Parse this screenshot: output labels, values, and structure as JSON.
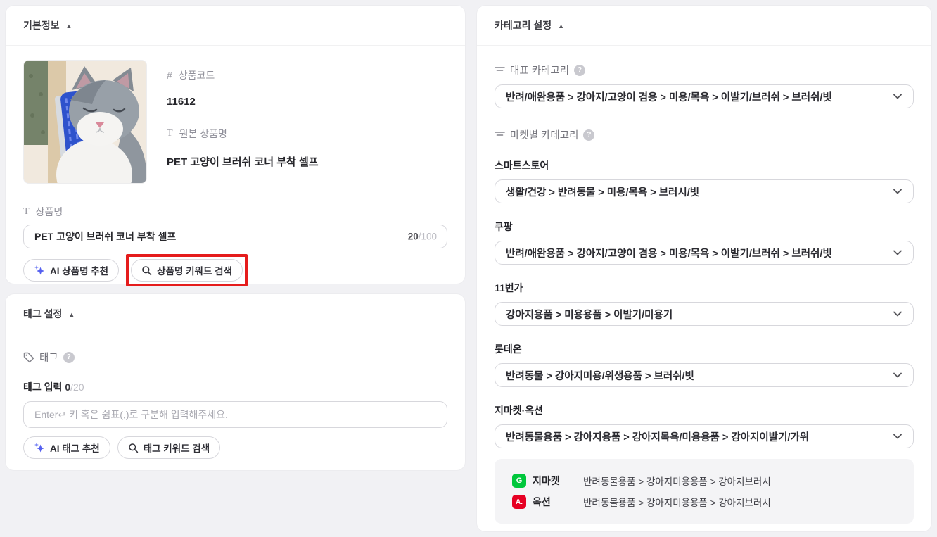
{
  "ui": {
    "collapse_icon": "▲",
    "help_glyph": "?"
  },
  "colors": {
    "accent_blue": "#5560f0",
    "annotation_red": "#e51c1c",
    "gmarket_green": "#00c73c",
    "auction_red": "#e60023"
  },
  "basic_info": {
    "title": "기본정보",
    "product_code_icon": "#",
    "product_code_label": "상품코드",
    "product_code_value": "11612",
    "text_icon": "T",
    "original_name_label": "원본 상품명",
    "original_name_value": "PET 고양이 브러쉬 코너 부착 셀프",
    "name_label": "상품명",
    "name_value": "PET 고양이 브러쉬 코너 부착 셀프",
    "name_count": "20",
    "name_limit": "/100",
    "ai_name_button": "AI 상품명 추천",
    "name_keyword_button": "상품명 키워드 검색"
  },
  "tag_settings": {
    "title": "태그 설정",
    "tag_label": "태그",
    "tag_input_label": "태그 입력",
    "tag_count": "0",
    "tag_limit": "/20",
    "tag_placeholder": "Enter↵ 키 혹은 쉼표(,)로 구분해 입력해주세요.",
    "ai_tag_button": "AI 태그 추천",
    "tag_keyword_button": "태그 키워드 검색"
  },
  "category_settings": {
    "title": "카테고리 설정",
    "main_category_label": "대표 카테고리",
    "main_category_value": "반려/애완용품 > 강아지/고양이 겸용 > 미용/목욕 > 이발기/브러쉬 > 브러쉬/빗",
    "market_category_label": "마켓별 카테고리",
    "markets": [
      {
        "name": "스마트스토어",
        "value": "생활/건강 > 반려동물 > 미용/목욕 > 브러시/빗"
      },
      {
        "name": "쿠팡",
        "value": "반려/애완용품 > 강아지/고양이 겸용 > 미용/목욕 > 이발기/브러쉬 > 브러쉬/빗"
      },
      {
        "name": "11번가",
        "value": "강아지용품 > 미용용품 > 이발기/미용기"
      },
      {
        "name": "롯데온",
        "value": "반려동물 > 강아지미용/위생용품 > 브러쉬/빗"
      },
      {
        "name": "지마켓·옥션",
        "value": "반려동물용품 > 강아지용품 > 강아지목욕/미용용품 > 강아지이발기/가위"
      }
    ],
    "linked_categories": [
      {
        "badge_letter": "G",
        "name": "지마켓",
        "path": "반려동물용품 > 강아지미용용품 > 강아지브러시"
      },
      {
        "badge_letter": "A.",
        "name": "옥션",
        "path": "반려동물용품 > 강아지미용용품 > 강아지브러시"
      }
    ]
  }
}
